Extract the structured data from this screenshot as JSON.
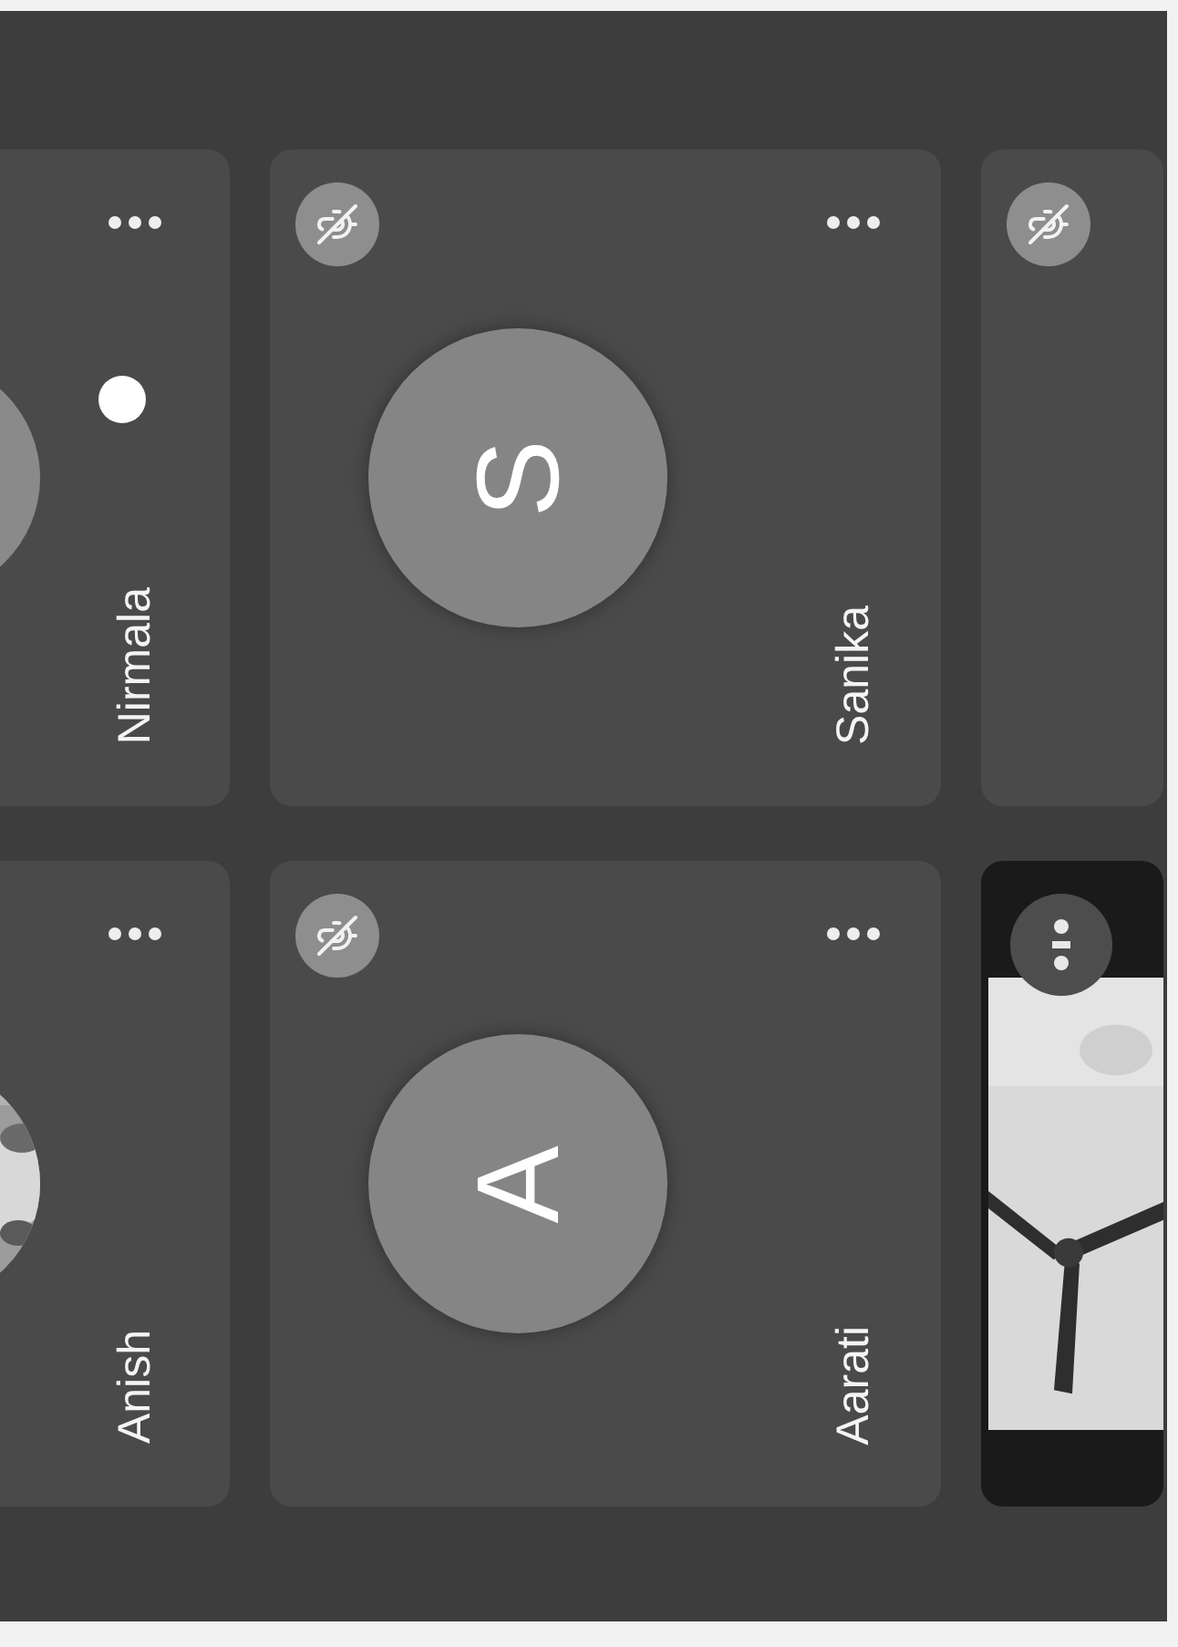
{
  "rows": [
    {
      "tiles": [
        {
          "kind": "initial-partial",
          "name": "Nirmala",
          "speaking": true
        },
        {
          "kind": "initial",
          "name": "Sanika",
          "initial": "S",
          "muted": true
        },
        {
          "kind": "blank",
          "muted": true
        }
      ]
    },
    {
      "tiles": [
        {
          "kind": "photo-partial",
          "name": "Anish"
        },
        {
          "kind": "initial",
          "name": "Aarati",
          "initial": "A",
          "muted": true
        },
        {
          "kind": "video"
        }
      ]
    }
  ]
}
